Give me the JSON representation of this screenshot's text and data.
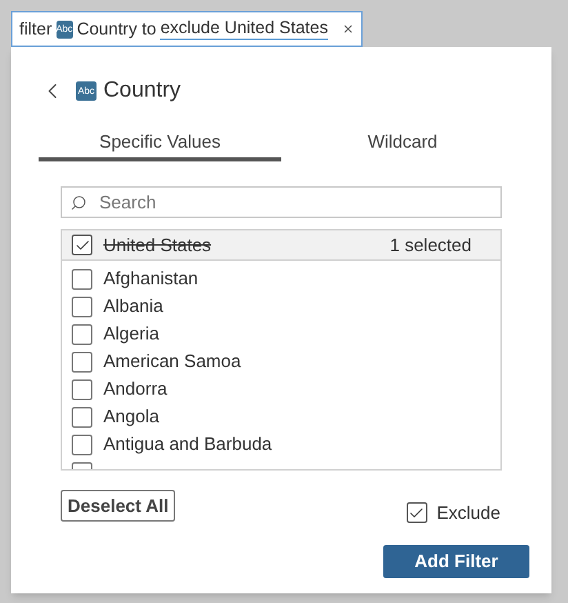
{
  "query": {
    "prefix": "filter",
    "badge": "Abc",
    "field": "Country to",
    "value": "exclude United States"
  },
  "panel": {
    "badge": "Abc",
    "title": "Country",
    "tabs": [
      {
        "label": "Specific Values",
        "selected": true
      },
      {
        "label": "Wildcard",
        "selected": false
      }
    ],
    "search": {
      "placeholder": "Search"
    },
    "selected_item": {
      "label": "United States",
      "checked": true
    },
    "selected_count": "1 selected",
    "items": [
      {
        "label": "Afghanistan",
        "checked": false
      },
      {
        "label": "Albania",
        "checked": false
      },
      {
        "label": "Algeria",
        "checked": false
      },
      {
        "label": "American Samoa",
        "checked": false
      },
      {
        "label": "Andorra",
        "checked": false
      },
      {
        "label": "Angola",
        "checked": false
      },
      {
        "label": "Antigua and Barbuda",
        "checked": false
      }
    ],
    "partial_row": {
      "checked": false
    },
    "deselect": "Deselect All",
    "exclude": {
      "label": "Exclude",
      "checked": true
    },
    "submit": "Add Filter"
  }
}
